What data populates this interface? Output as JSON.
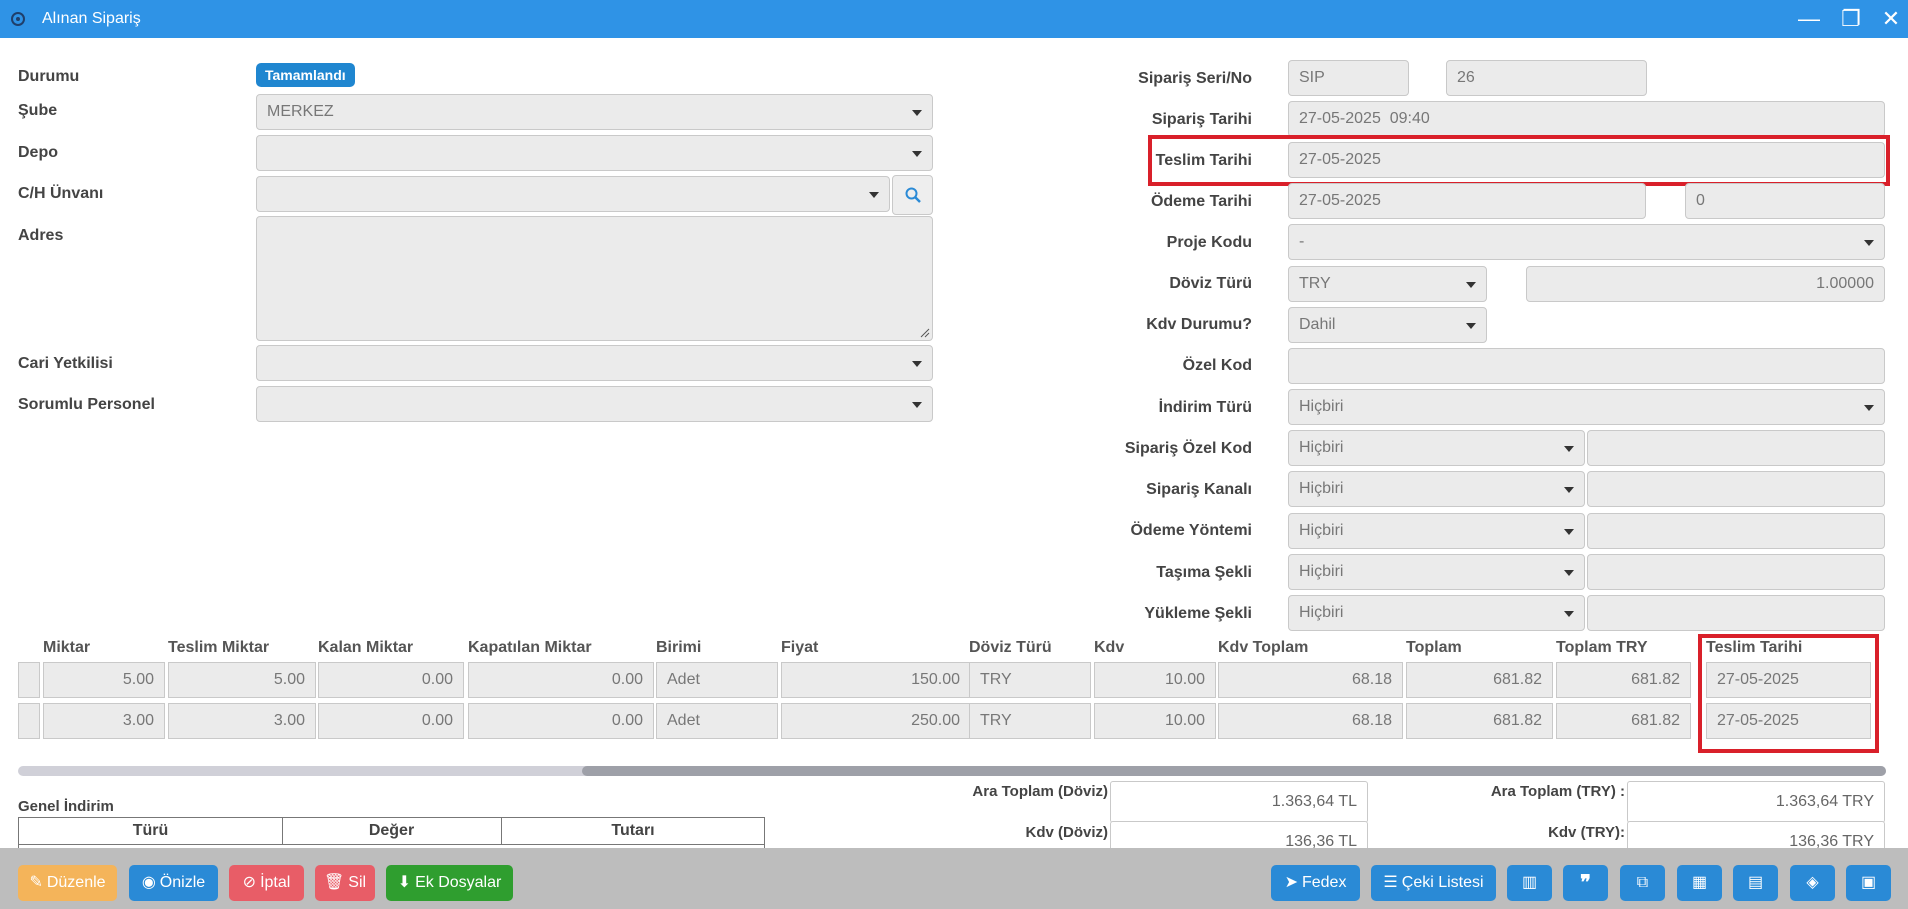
{
  "window": {
    "title": "Alınan Sipariş",
    "app_icon": "gear-icon",
    "minimize": "—",
    "restore": "❐",
    "close": "✕"
  },
  "left": {
    "durumu_label": "Durumu",
    "durumu_badge": "Tamamlandı",
    "sube_label": "Şube",
    "sube_value": "MERKEZ",
    "depo_label": "Depo",
    "depo_value": "",
    "ch_label": "C/H Ünvanı",
    "ch_value": "",
    "adres_label": "Adres",
    "adres_value": "",
    "cari_yetkilisi_label": "Cari Yetkilisi",
    "cari_yetkilisi_value": "",
    "sorumlu_label": "Sorumlu Personel",
    "sorumlu_value": ""
  },
  "right": {
    "seri_label": "Sipariş Seri/No",
    "seri_value": "SIP",
    "no_value": "26",
    "siparis_tarihi_label": "Sipariş Tarihi",
    "siparis_tarihi_value": "27-05-2025  09:40",
    "teslim_tarihi_label": "Teslim Tarihi",
    "teslim_tarihi_value": "27-05-2025",
    "odeme_tarihi_label": "Ödeme Tarihi",
    "odeme_tarihi_value": "27-05-2025",
    "odeme_gun_value": "0",
    "proje_kodu_label": "Proje Kodu",
    "proje_kodu_value": "-",
    "doviz_turu_label": "Döviz Türü",
    "doviz_turu_value": "TRY",
    "kur_value": "1.00000",
    "kdv_durumu_label": "Kdv Durumu?",
    "kdv_durumu_value": "Dahil",
    "ozel_kod_label": "Özel Kod",
    "ozel_kod_value": "",
    "indirim_turu_label": "İndirim Türü",
    "indirim_turu_value": "Hiçbiri",
    "siparis_ozel_kod_label": "Sipariş Özel Kod",
    "siparis_ozel_kod_value": "Hiçbiri",
    "siparis_kanali_label": "Sipariş Kanalı",
    "siparis_kanali_value": "Hiçbiri",
    "odeme_yontemi_label": "Ödeme Yöntemi",
    "odeme_yontemi_value": "Hiçbiri",
    "tasima_sekli_label": "Taşıma Şekli",
    "tasima_sekli_value": "Hiçbiri",
    "yukleme_sekli_label": "Yükleme Şekli",
    "yukleme_sekli_value": "Hiçbiri"
  },
  "grid": {
    "headers": [
      "Miktar",
      "Teslim Miktar",
      "Kalan Miktar",
      "Kapatılan Miktar",
      "Birimi",
      "Fiyat",
      "Döviz Türü",
      "Kdv",
      "Kdv Toplam",
      "Toplam",
      "Toplam TRY",
      "Teslim Tarihi"
    ],
    "rows": [
      [
        "5.00",
        "5.00",
        "0.00",
        "0.00",
        "Adet",
        "150.00",
        "TRY",
        "10.00",
        "68.18",
        "681.82",
        "681.82",
        "27-05-2025"
      ],
      [
        "3.00",
        "3.00",
        "0.00",
        "0.00",
        "Adet",
        "250.00",
        "TRY",
        "10.00",
        "68.18",
        "681.82",
        "681.82",
        "27-05-2025"
      ]
    ],
    "horizontal_scroll_position": 0.31
  },
  "discount": {
    "title": "Genel İndirim",
    "headers": [
      "Türü",
      "Değer",
      "Tutarı"
    ]
  },
  "totals": {
    "ara_toplam_doviz_label": "Ara Toplam (Döviz)",
    "ara_toplam_doviz_value": "1.363,64 TL",
    "ara_toplam_try_label": "Ara Toplam (TRY) :",
    "ara_toplam_try_value": "1.363,64 TRY",
    "kdv_doviz_label": "Kdv (Döviz)",
    "kdv_doviz_value": "136,36 TL",
    "kdv_try_label": "Kdv (TRY):",
    "kdv_try_value": "136,36 TRY"
  },
  "toolbar": {
    "duzenle": "Düzenle",
    "onizle": "Önizle",
    "iptal": "İptal",
    "sil": "Sil",
    "ek_dosyalar": "Ek Dosyalar",
    "fedex": "Fedex",
    "ceki_listesi": "Çeki Listesi"
  },
  "colors": {
    "titlebar": "#2f93e6",
    "primary": "#2a8ad6",
    "highlight": "#d9202a",
    "success": "#2f9e2f",
    "warning": "#f4b45a",
    "danger": "#e85d67"
  }
}
